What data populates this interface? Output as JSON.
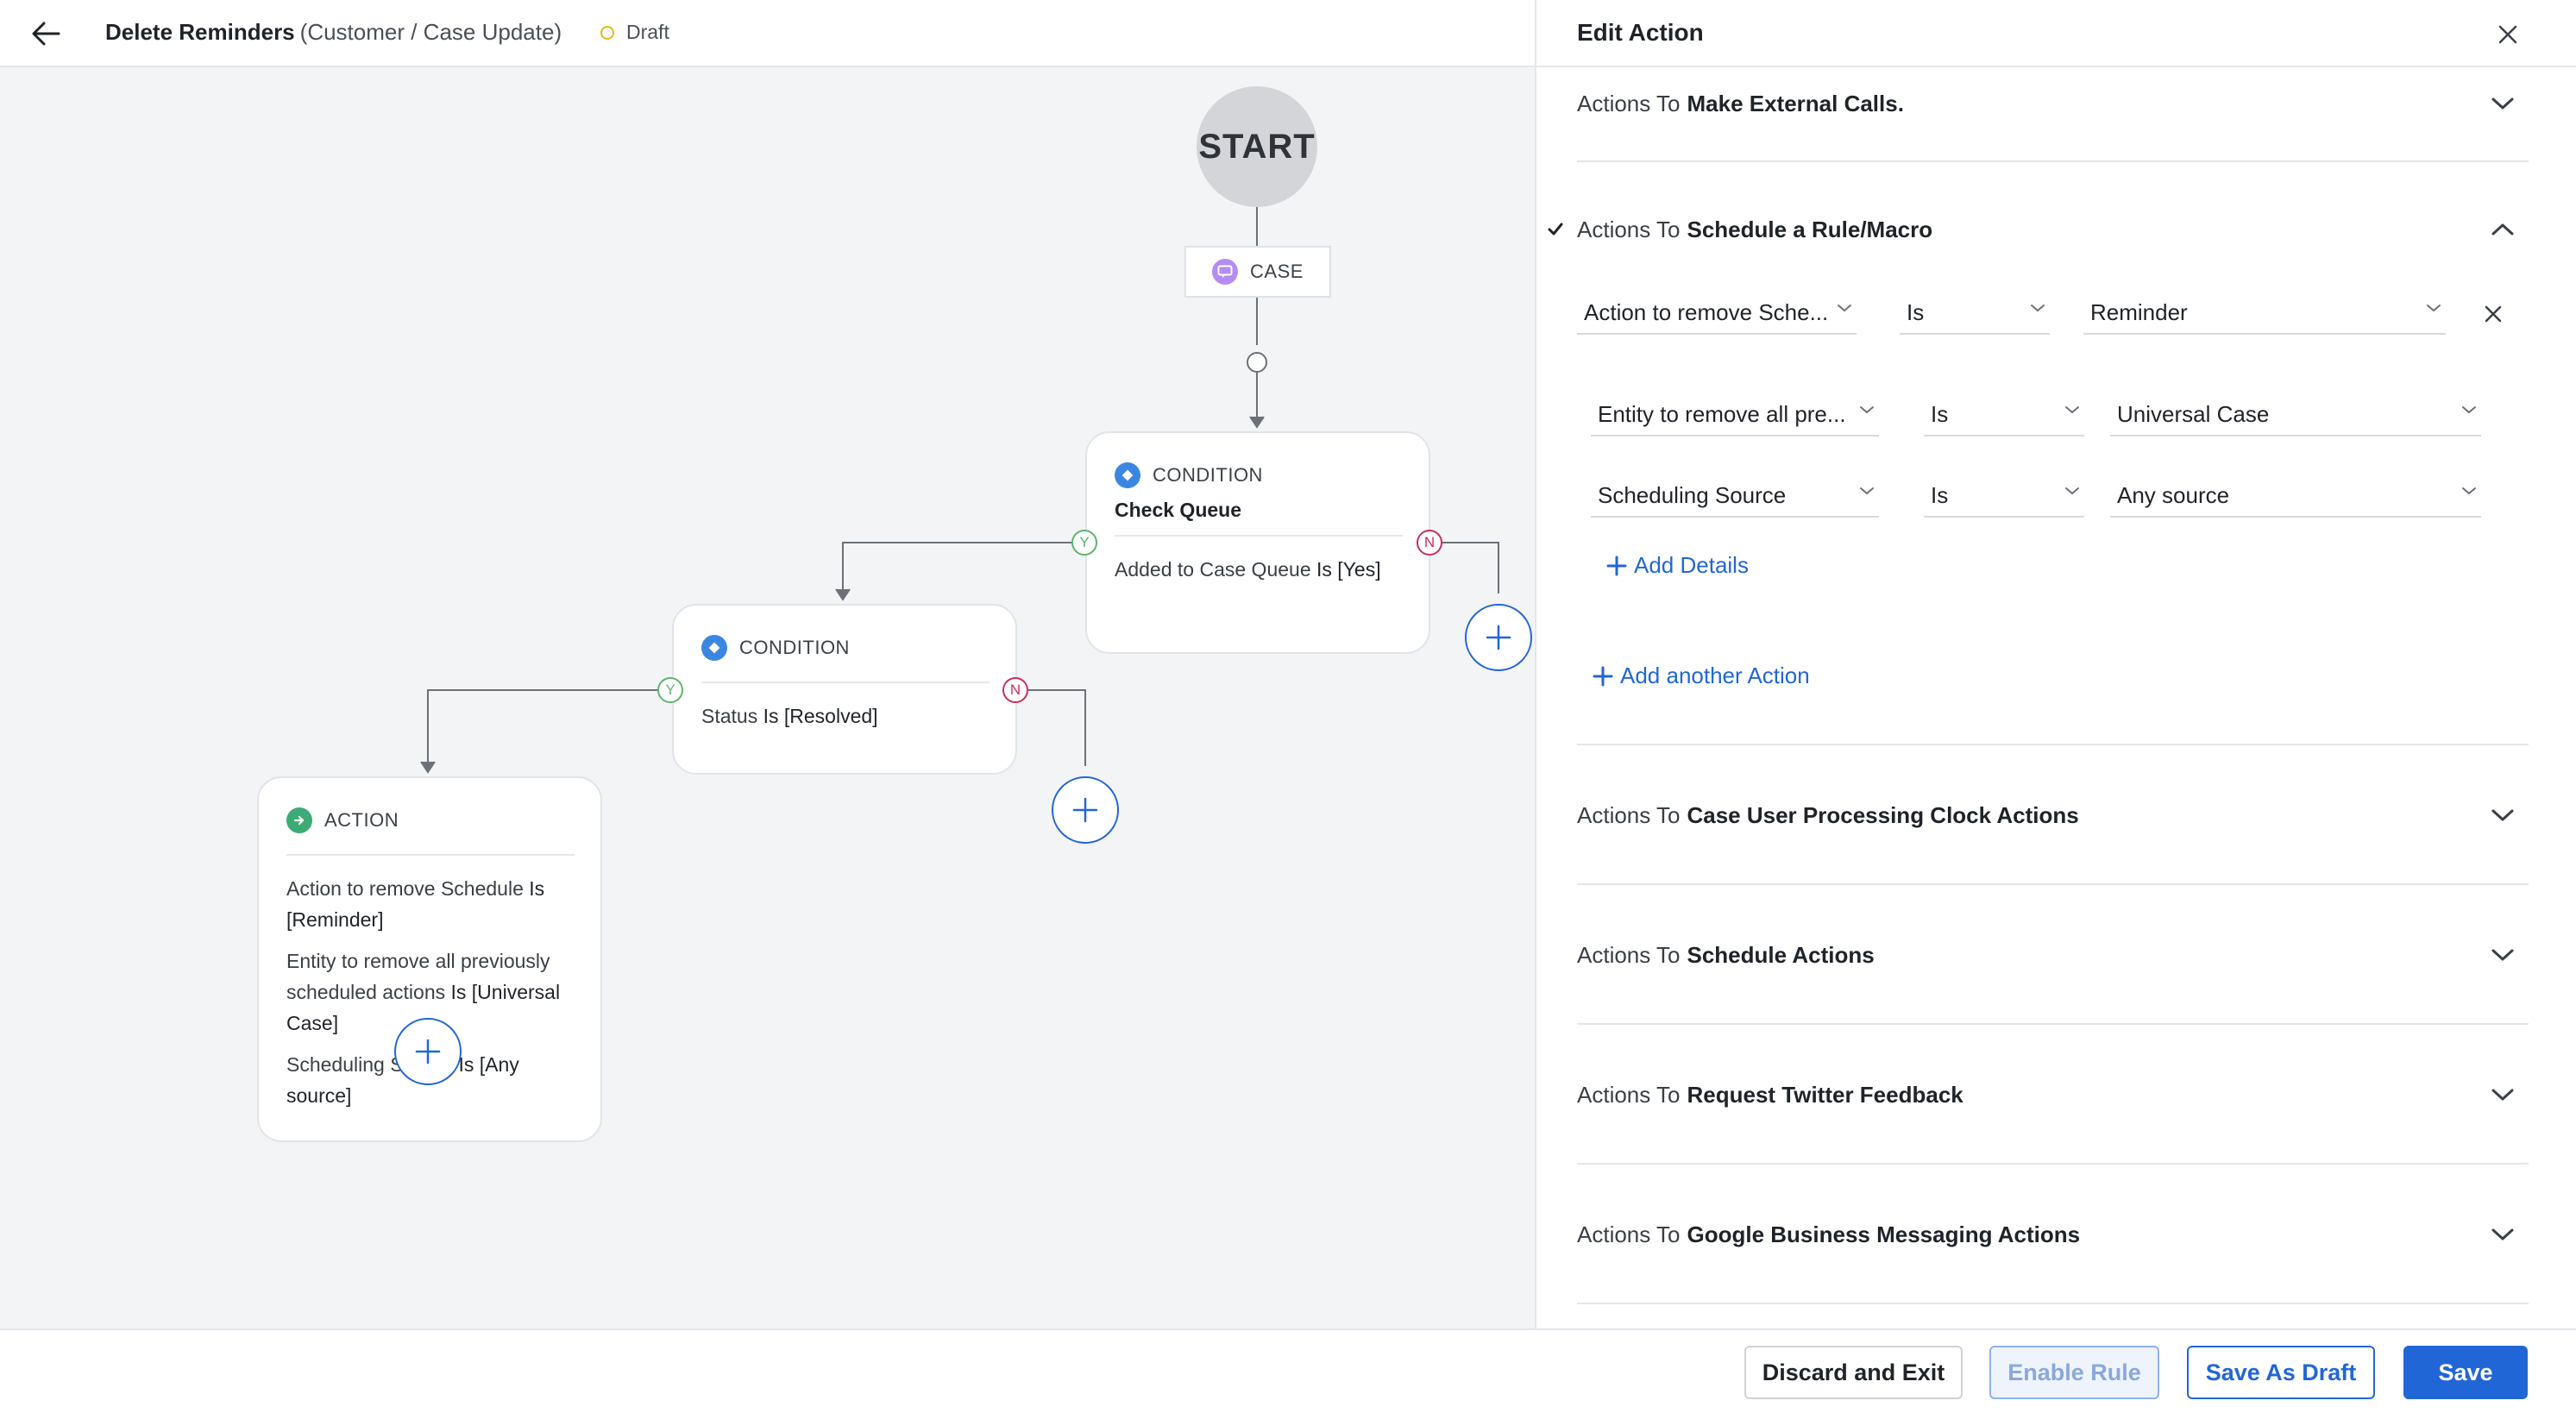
{
  "header": {
    "title": "Delete Reminders",
    "subtitle": "(Customer / Case Update)",
    "status": "Draft"
  },
  "canvas": {
    "start_label": "START",
    "case_label": "CASE",
    "condition1": {
      "type": "CONDITION",
      "name": "Check Queue",
      "text_prefix": "Added to Case Queue",
      "text_op": "Is",
      "text_value": "[Yes]"
    },
    "condition2": {
      "type": "CONDITION",
      "text_prefix": "Status",
      "text_op": "Is",
      "text_value": "[Resolved]"
    },
    "action": {
      "type": "ACTION",
      "line1_prefix": "Action to remove Schedule",
      "line1_op": "Is",
      "line1_value": "[Reminder]",
      "line2_prefix": "Entity to remove all previously scheduled actions",
      "line2_op": "Is",
      "line2_value": "[Universal Case]",
      "line3_prefix": "Scheduling Source",
      "line3_op": "Is",
      "line3_value": "[Any source]"
    },
    "yes": "Y",
    "no": "N"
  },
  "panel": {
    "title": "Edit Action",
    "sections": [
      {
        "prefix": "Actions To",
        "name": "Make External Calls."
      },
      {
        "prefix": "Actions To",
        "name": "Schedule a Rule/Macro"
      },
      {
        "prefix": "Actions To",
        "name": "Case User Processing Clock Actions"
      },
      {
        "prefix": "Actions To",
        "name": "Schedule Actions"
      },
      {
        "prefix": "Actions To",
        "name": "Request Twitter Feedback"
      },
      {
        "prefix": "Actions To",
        "name": "Google Business Messaging Actions"
      }
    ],
    "row1": {
      "field": "Action to remove Sche...",
      "op": "Is",
      "value": "Reminder"
    },
    "row2": {
      "field": "Entity to remove all pre...",
      "op": "Is",
      "value": "Universal Case"
    },
    "row3": {
      "field": "Scheduling Source",
      "op": "Is",
      "value": "Any source"
    },
    "add_details": "Add Details",
    "add_another_action": "Add another Action"
  },
  "footer": {
    "discard": "Discard and Exit",
    "enable": "Enable Rule",
    "save_draft": "Save As Draft",
    "save": "Save"
  },
  "colors": {
    "accent": "#2166d6",
    "yes": "#5fb46c",
    "no": "#c92f5d",
    "draft": "#e6b714",
    "action_icon": "#3cab75",
    "case_icon": "#b48cf2"
  }
}
